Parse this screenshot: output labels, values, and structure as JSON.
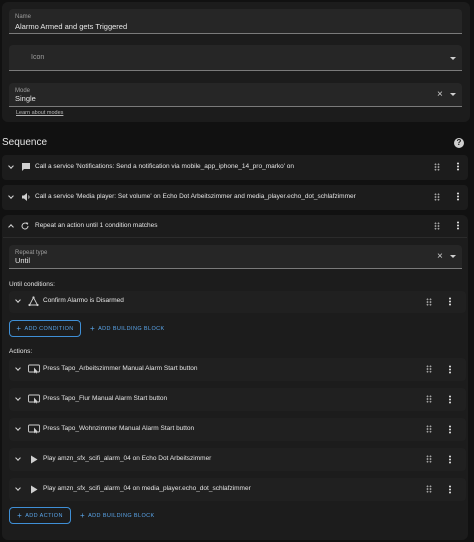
{
  "form": {
    "name_label": "Name",
    "name_value": "Alarmo Armed and gets Triggered",
    "icon_label": "Icon",
    "mode_label": "Mode",
    "mode_value": "Single",
    "learn_modes_link": "Learn about modes"
  },
  "sequence": {
    "title": "Sequence",
    "help_glyph": "?",
    "actions": [
      {
        "title": "Call a service 'Notifications: Send a notification via mobile_app_iphone_14_pro_marko' on",
        "icon": "message-icon"
      },
      {
        "title": "Call a service 'Media player: Set volume' on Echo Dot Arbeitszimmer and media_player.echo_dot_schlafzimmer",
        "icon": "speaker-icon"
      },
      {
        "title": "Repeat an action until 1 condition matches",
        "icon": "refresh-icon"
      }
    ],
    "repeat": {
      "repeat_type_label": "Repeat type",
      "repeat_type_value": "Until",
      "until_conditions_label": "Until conditions:",
      "conditions": [
        {
          "title": "Confirm Alarmo is Disarmed",
          "icon": "triangle-nodes-icon"
        }
      ],
      "add_condition_label": "ADD CONDITION",
      "add_building_block_label": "ADD BUILDING BLOCK",
      "actions_label": "Actions:",
      "inner_actions": [
        {
          "title": "Press Tapo_Arbeitszimmer Manual Alarm Start button",
          "icon": "button-press-icon"
        },
        {
          "title": "Press Tapo_Flur Manual Alarm Start button",
          "icon": "button-press-icon"
        },
        {
          "title": "Press Tapo_Wohnzimmer Manual Alarm Start button",
          "icon": "button-press-icon"
        },
        {
          "title": "Play amzn_sfx_scifi_alarm_04 on Echo Dot Arbeitszimmer",
          "icon": "play-icon"
        },
        {
          "title": "Play amzn_sfx_scifi_alarm_04 on media_player.echo_dot_schlafzimmer",
          "icon": "play-icon"
        }
      ],
      "add_action_label": "ADD ACTION",
      "add_building_block_label_2": "ADD BUILDING BLOCK"
    }
  },
  "colors": {
    "background": "#111111",
    "card": "#1c1c1c",
    "field": "#262626",
    "accent": "#5aa5ea"
  }
}
